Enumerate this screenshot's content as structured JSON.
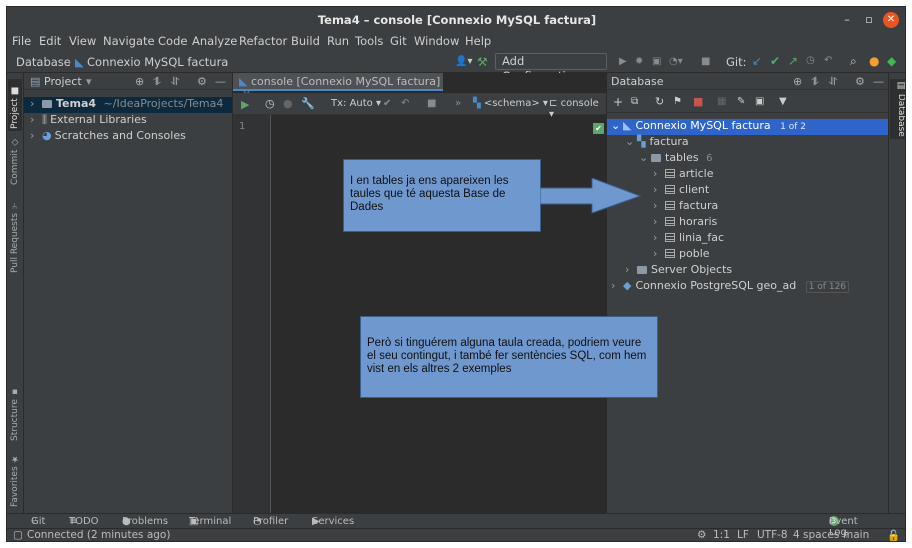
{
  "window": {
    "title": "Tema4 – console [Connexio MySQL factura]"
  },
  "menu": [
    "File",
    "Edit",
    "View",
    "Navigate",
    "Code",
    "Analyze",
    "Refactor",
    "Build",
    "Run",
    "Tools",
    "Git",
    "Window",
    "Help"
  ],
  "breadcrumb": {
    "root": "Database",
    "item": "Connexio MySQL factura"
  },
  "toolbar": {
    "add_configuration": "Add Configuration...",
    "git_label": "Git:"
  },
  "left_tabs": {
    "project": "Project",
    "commit": "Commit",
    "pull_requests": "Pull Requests",
    "structure": "Structure",
    "favorites": "Favorites"
  },
  "project": {
    "header": "Project",
    "items": [
      {
        "name": "Tema4",
        "path": "~/IdeaProjects/Tema4"
      },
      {
        "name": "External Libraries"
      },
      {
        "name": "Scratches and Consoles"
      }
    ]
  },
  "editor": {
    "tab": "console [Connexio MySQL factura]",
    "tx_mode": "Tx: Auto",
    "schema": "<schema>",
    "console": "console",
    "line_number": "1"
  },
  "database": {
    "header": "Database",
    "connection": "Connexio MySQL factura",
    "connection_count": "1 of 2",
    "schema": "factura",
    "tables_label": "tables",
    "tables_count": "6",
    "tables": [
      "article",
      "client",
      "factura",
      "horaris",
      "linia_fac",
      "poble"
    ],
    "server_objects": "Server Objects",
    "connection2": "Connexio PostgreSQL geo_ad",
    "connection2_count": "1 of 126"
  },
  "right_tab": "Database",
  "notes": {
    "note1": "I en tables ja ens apareixen les taules que té aquesta Base de Dades",
    "note2": "Però si tinguérem alguna taula creada, podriem veure el seu contingut, i també fer sentències SQL, com hem vist en els altres 2 exemples"
  },
  "bottom_tabs": {
    "git": "Git",
    "todo": "TODO",
    "problems": "Problems",
    "terminal": "Terminal",
    "profiler": "Profiler",
    "services": "Services",
    "event_log": "Event Log",
    "event_count": "3"
  },
  "status": {
    "message": "Connected (2 minutes ago)",
    "position": "1:1",
    "line_sep": "LF",
    "encoding": "UTF-8",
    "indent": "4 spaces",
    "branch": "main"
  },
  "colors": {
    "accent": "#4a88c7",
    "selection": "#0d293e",
    "note_fill": "#6f98cf",
    "close_button": "#e95420"
  }
}
